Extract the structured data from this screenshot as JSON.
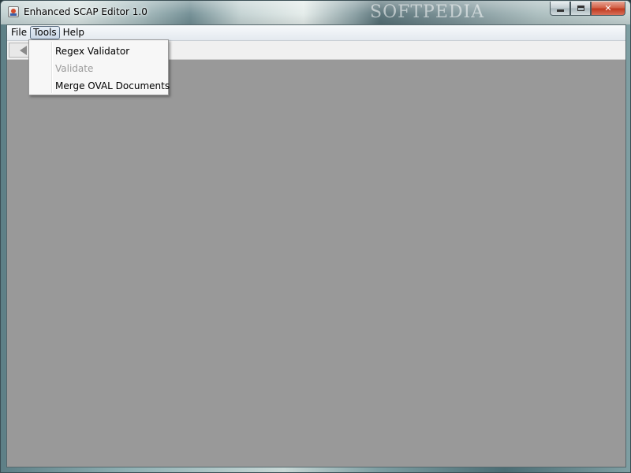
{
  "window": {
    "title": "Enhanced SCAP Editor 1.0",
    "watermark": "SOFTPEDIA",
    "controls": {
      "minimize_icon": "minimize-icon",
      "maximize_icon": "maximize-icon",
      "close_icon": "close-icon",
      "close_glyph": "✕"
    }
  },
  "menubar": {
    "items": [
      {
        "label": "File"
      },
      {
        "label": "Tools",
        "active": true
      },
      {
        "label": "Help"
      }
    ]
  },
  "toolbar": {
    "back_icon": "back-arrow-icon"
  },
  "tools_menu": {
    "items": [
      {
        "label": "Regex Validator",
        "enabled": true
      },
      {
        "label": "Validate",
        "enabled": false
      },
      {
        "label": "Merge OVAL Documents",
        "enabled": true
      }
    ]
  },
  "colors": {
    "workspace": "#999999",
    "menu_background": "#f7f7f7",
    "disabled_text": "#9a9a9a",
    "close_button": "#c0391f"
  }
}
